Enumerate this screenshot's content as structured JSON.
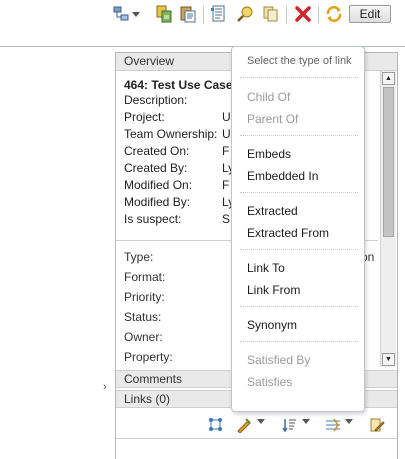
{
  "toolbar": {
    "edit_label": "Edit",
    "icons": [
      "hierarchy-icon",
      "dropdown-caret-icon",
      "copy-artifact-icon",
      "paste-icon",
      "properties-icon",
      "find-icon",
      "duplicate-icon",
      "delete-icon",
      "refresh-icon"
    ]
  },
  "overview": {
    "header": "Overview",
    "title": "464: Test Use Case",
    "fields": [
      {
        "label": "Description:",
        "value": ""
      },
      {
        "label": "Project:",
        "value": "U"
      },
      {
        "label": "Team Ownership:",
        "value": "U"
      },
      {
        "label": "Created On:",
        "value": "F"
      },
      {
        "label": "Created By:",
        "value": "Ly"
      },
      {
        "label": "Modified On:",
        "value": "F"
      },
      {
        "label": "Modified By:",
        "value": "Ly"
      },
      {
        "label": "Is suspect:",
        "value": "S"
      }
    ],
    "attributes": [
      {
        "label": "Type:",
        "value": "on"
      },
      {
        "label": "Format:",
        "value": ""
      },
      {
        "label": "Priority:",
        "value": ""
      },
      {
        "label": "Status:",
        "value": ""
      },
      {
        "label": "Owner:",
        "value": ""
      },
      {
        "label": "Property:",
        "value": ""
      }
    ]
  },
  "comments": {
    "header": "Comments"
  },
  "links": {
    "header": "Links (0)"
  },
  "link_menu": {
    "heading": "Select the type of link",
    "items": [
      {
        "label": "Child Of",
        "enabled": false
      },
      {
        "label": "Parent Of",
        "enabled": false
      },
      {
        "label": "Embeds",
        "enabled": true
      },
      {
        "label": "Embedded In",
        "enabled": true
      },
      {
        "label": "Extracted",
        "enabled": true
      },
      {
        "label": "Extracted From",
        "enabled": true
      },
      {
        "label": "Link To",
        "enabled": true
      },
      {
        "label": "Link From",
        "enabled": true
      },
      {
        "label": "Synonym",
        "enabled": true
      },
      {
        "label": "Satisfied By",
        "enabled": false
      },
      {
        "label": "Satisfies",
        "enabled": false
      }
    ]
  },
  "colors": {
    "delete": "#d4222a",
    "menu_border": "#b9c7d6",
    "section_header": "#e9e9e9"
  }
}
